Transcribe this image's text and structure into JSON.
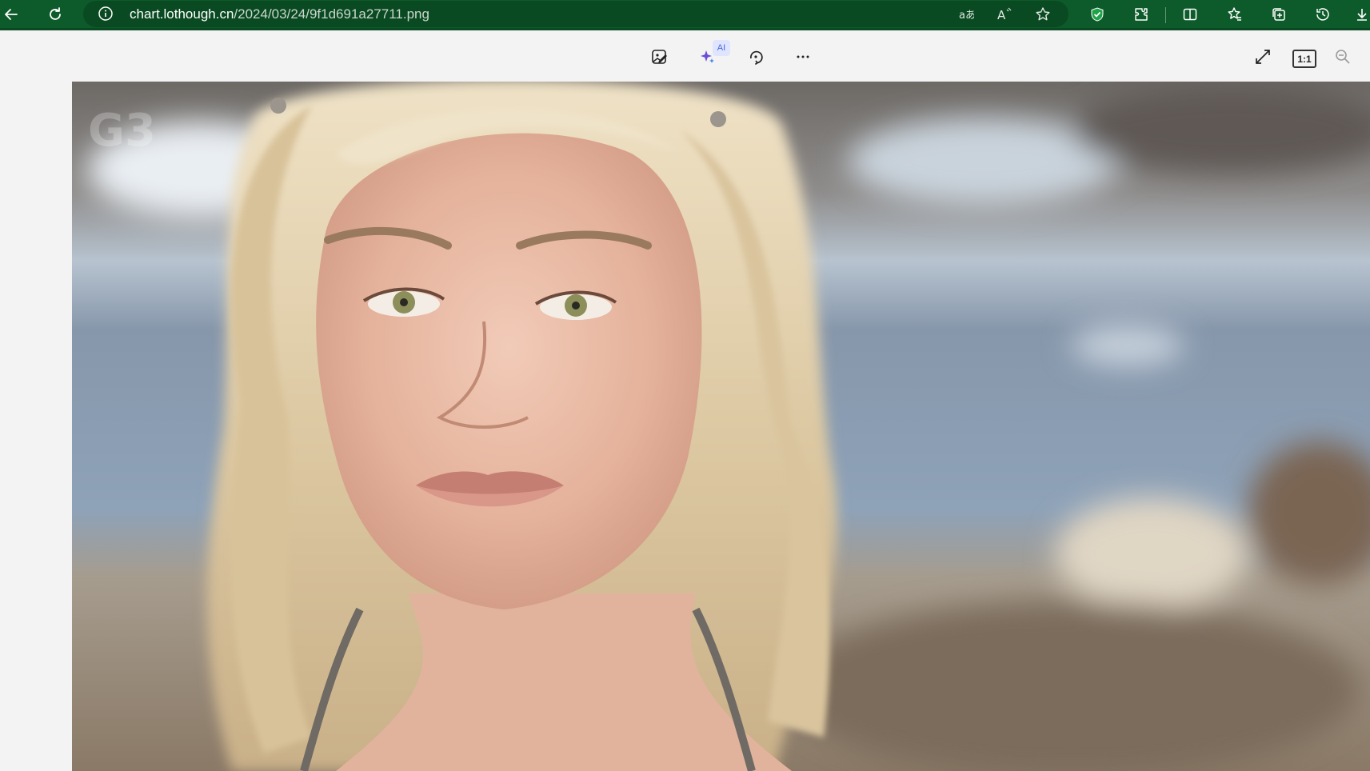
{
  "browser": {
    "url_host": "chart.lothough.cn",
    "url_path": "/2024/03/24/9f1d691a27711.png",
    "nav": {
      "back_icon": "back-arrow-icon",
      "refresh_icon": "refresh-icon",
      "info_icon": "info-icon"
    },
    "toolbar_icons": [
      "translate-icon",
      "read-aloud-icon",
      "favorite-star-icon",
      "shield-icon",
      "extensions-icon",
      "split-screen-icon",
      "favorites-icon",
      "collections-icon",
      "history-icon",
      "downloads-icon"
    ]
  },
  "viewer": {
    "tools": [
      "edit-image-icon",
      "ai-sparkle-icon",
      "rotate-icon",
      "more-icon",
      "fullscreen-icon",
      "actual-size-icon",
      "zoom-out-icon"
    ],
    "ai_badge": "AI",
    "actual_size_label": "1:1"
  },
  "image": {
    "description_type": "photo",
    "watermark": "G3"
  },
  "colors": {
    "topbar": "#0d5a2a",
    "addressbar": "#0a4a22",
    "viewer_bg": "#f3f3f3"
  }
}
